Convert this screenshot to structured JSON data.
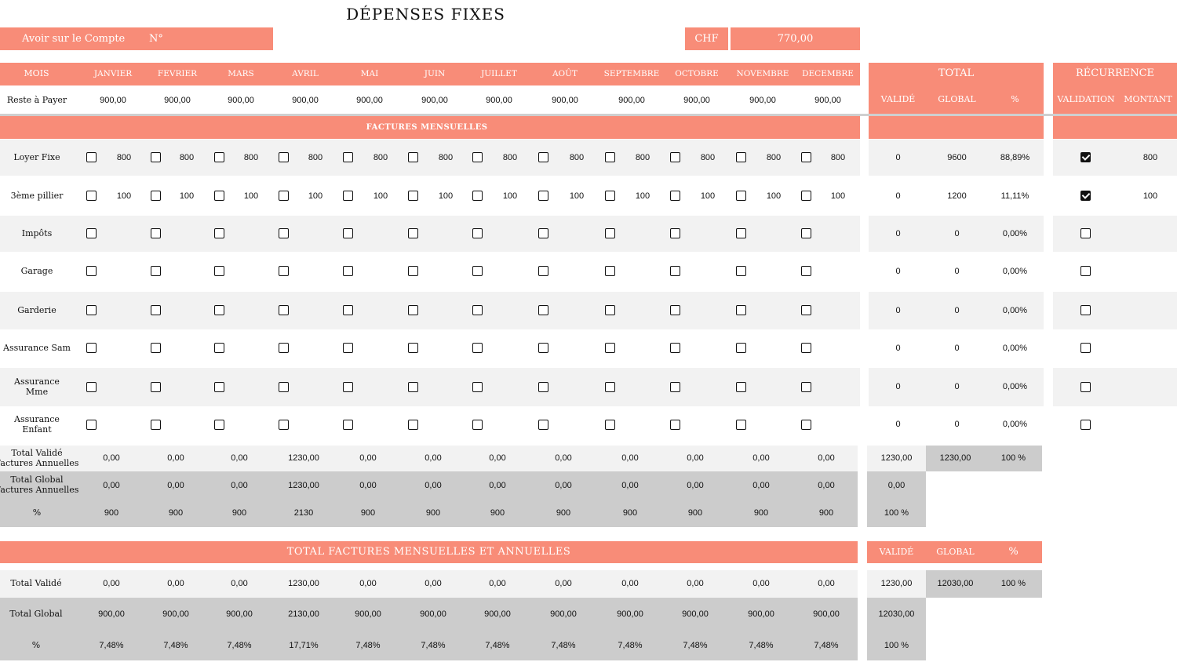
{
  "title": "DÉPENSES FIXES",
  "account": {
    "label": "Avoir sur le Compte",
    "no_label": "N°",
    "currency": "CHF",
    "amount": "770,00"
  },
  "months_header": {
    "mois": "MOIS",
    "months": [
      "JANVIER",
      "FEVRIER",
      "MARS",
      "AVRIL",
      "MAI",
      "JUIN",
      "JUILLET",
      "AOÛT",
      "SEPTEMBRE",
      "OCTOBRE",
      "NOVEMBRE",
      "DECEMBRE"
    ]
  },
  "reste": {
    "label": "Reste à Payer",
    "values": [
      "900,00",
      "900,00",
      "900,00",
      "900,00",
      "900,00",
      "900,00",
      "900,00",
      "900,00",
      "900,00",
      "900,00",
      "900,00",
      "900,00"
    ]
  },
  "total_header": {
    "title": "TOTAL",
    "valide": "VALIDÉ",
    "global": "GLOBAL",
    "pct": "%"
  },
  "recurrence_header": {
    "title": "RÉCURRENCE",
    "validation": "VALIDATION",
    "montant": "MONTANT"
  },
  "section_mensuelles": "FACTURES MENSUELLES",
  "rows": [
    {
      "label": "Loyer Fixe",
      "amount": "800",
      "checks": [
        false,
        false,
        false,
        false,
        false,
        false,
        false,
        false,
        false,
        false,
        false,
        false
      ],
      "valide": "0",
      "global": "9600",
      "pct": "88,89%",
      "rec_checked": true,
      "montant": "800"
    },
    {
      "label": "3ème pillier",
      "amount": "100",
      "checks": [
        false,
        false,
        false,
        false,
        false,
        false,
        false,
        false,
        false,
        false,
        false,
        false
      ],
      "valide": "0",
      "global": "1200",
      "pct": "11,11%",
      "rec_checked": true,
      "montant": "100"
    },
    {
      "label": "Impôts",
      "amount": "",
      "checks": [
        false,
        false,
        false,
        false,
        false,
        false,
        false,
        false,
        false,
        false,
        false,
        false
      ],
      "valide": "0",
      "global": "0",
      "pct": "0,00%",
      "rec_checked": false,
      "montant": ""
    },
    {
      "label": "Garage",
      "amount": "",
      "checks": [
        false,
        false,
        false,
        false,
        false,
        false,
        false,
        false,
        false,
        false,
        false,
        false
      ],
      "valide": "0",
      "global": "0",
      "pct": "0,00%",
      "rec_checked": false,
      "montant": ""
    },
    {
      "label": "Garderie",
      "amount": "",
      "checks": [
        false,
        false,
        false,
        false,
        false,
        false,
        false,
        false,
        false,
        false,
        false,
        false
      ],
      "valide": "0",
      "global": "0",
      "pct": "0,00%",
      "rec_checked": false,
      "montant": ""
    },
    {
      "label": "Assurance Sam",
      "amount": "",
      "checks": [
        false,
        false,
        false,
        false,
        false,
        false,
        false,
        false,
        false,
        false,
        false,
        false
      ],
      "valide": "0",
      "global": "0",
      "pct": "0,00%",
      "rec_checked": false,
      "montant": ""
    },
    {
      "label": "Assurance Mme",
      "amount": "",
      "checks": [
        false,
        false,
        false,
        false,
        false,
        false,
        false,
        false,
        false,
        false,
        false,
        false
      ],
      "valide": "0",
      "global": "0",
      "pct": "0,00%",
      "rec_checked": false,
      "montant": ""
    },
    {
      "label": "Assurance Enfant",
      "amount": "",
      "checks": [
        false,
        false,
        false,
        false,
        false,
        false,
        false,
        false,
        false,
        false,
        false,
        false
      ],
      "valide": "0",
      "global": "0",
      "pct": "0,00%",
      "rec_checked": false,
      "montant": ""
    }
  ],
  "annual": {
    "total_valide": {
      "label": "Total Validé Factures Annuelles",
      "values": [
        "0,00",
        "0,00",
        "0,00",
        "1230,00",
        "0,00",
        "0,00",
        "0,00",
        "0,00",
        "0,00",
        "0,00",
        "0,00",
        "0,00"
      ],
      "valide": "1230,00",
      "global": "1230,00",
      "pct": "100 %"
    },
    "total_global": {
      "label": "Total Global Factures Annuelles",
      "values": [
        "0,00",
        "0,00",
        "0,00",
        "1230,00",
        "0,00",
        "0,00",
        "0,00",
        "0,00",
        "0,00",
        "0,00",
        "0,00",
        "0,00"
      ],
      "valide": "0,00"
    },
    "pct": {
      "label": "%",
      "values": [
        "900",
        "900",
        "900",
        "2130",
        "900",
        "900",
        "900",
        "900",
        "900",
        "900",
        "900",
        "900"
      ],
      "valide": "100 %"
    }
  },
  "section_total": "TOTAL FACTURES MENSUELLES ET ANNUELLES",
  "total_header2": {
    "valide": "VALIDÉ",
    "global": "GLOBAL",
    "pct": "%"
  },
  "final": {
    "total_valide": {
      "label": "Total Validé",
      "values": [
        "0,00",
        "0,00",
        "0,00",
        "1230,00",
        "0,00",
        "0,00",
        "0,00",
        "0,00",
        "0,00",
        "0,00",
        "0,00",
        "0,00"
      ],
      "valide": "1230,00",
      "global": "12030,00",
      "pct": "100 %"
    },
    "total_global": {
      "label": "Total Global",
      "values": [
        "900,00",
        "900,00",
        "900,00",
        "2130,00",
        "900,00",
        "900,00",
        "900,00",
        "900,00",
        "900,00",
        "900,00",
        "900,00",
        "900,00"
      ],
      "valide": "12030,00"
    },
    "pct": {
      "label": "%",
      "values": [
        "7,48%",
        "7,48%",
        "7,48%",
        "17,71%",
        "7,48%",
        "7,48%",
        "7,48%",
        "7,48%",
        "7,48%",
        "7,48%",
        "7,48%",
        "7,48%"
      ],
      "valide": "100 %"
    }
  },
  "colors": {
    "accent": "#f88c78",
    "light": "#f2f2f2",
    "gray": "#cccccc"
  }
}
